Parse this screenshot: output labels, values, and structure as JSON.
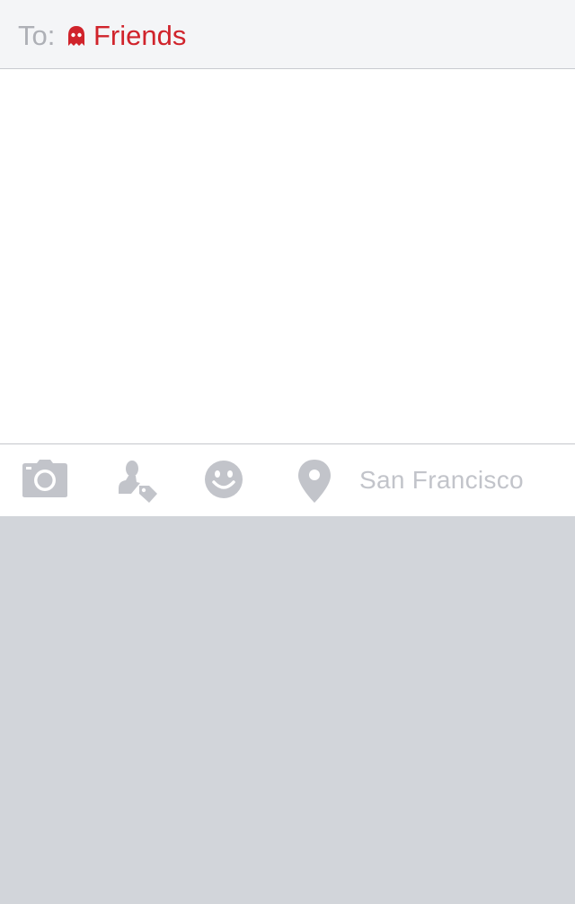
{
  "header": {
    "to_label": "To:",
    "recipient": "Friends",
    "recipient_icon": "ghost-icon"
  },
  "toolbar": {
    "icons": [
      "camera-icon",
      "tag-person-icon",
      "smiley-icon",
      "location-pin-icon"
    ],
    "location_text": "San Francisco"
  },
  "colors": {
    "accent": "#d0232b",
    "header_bg": "#f4f5f7",
    "icon_gray": "#c2c4ca",
    "keyboard_bg": "#d2d5da"
  }
}
